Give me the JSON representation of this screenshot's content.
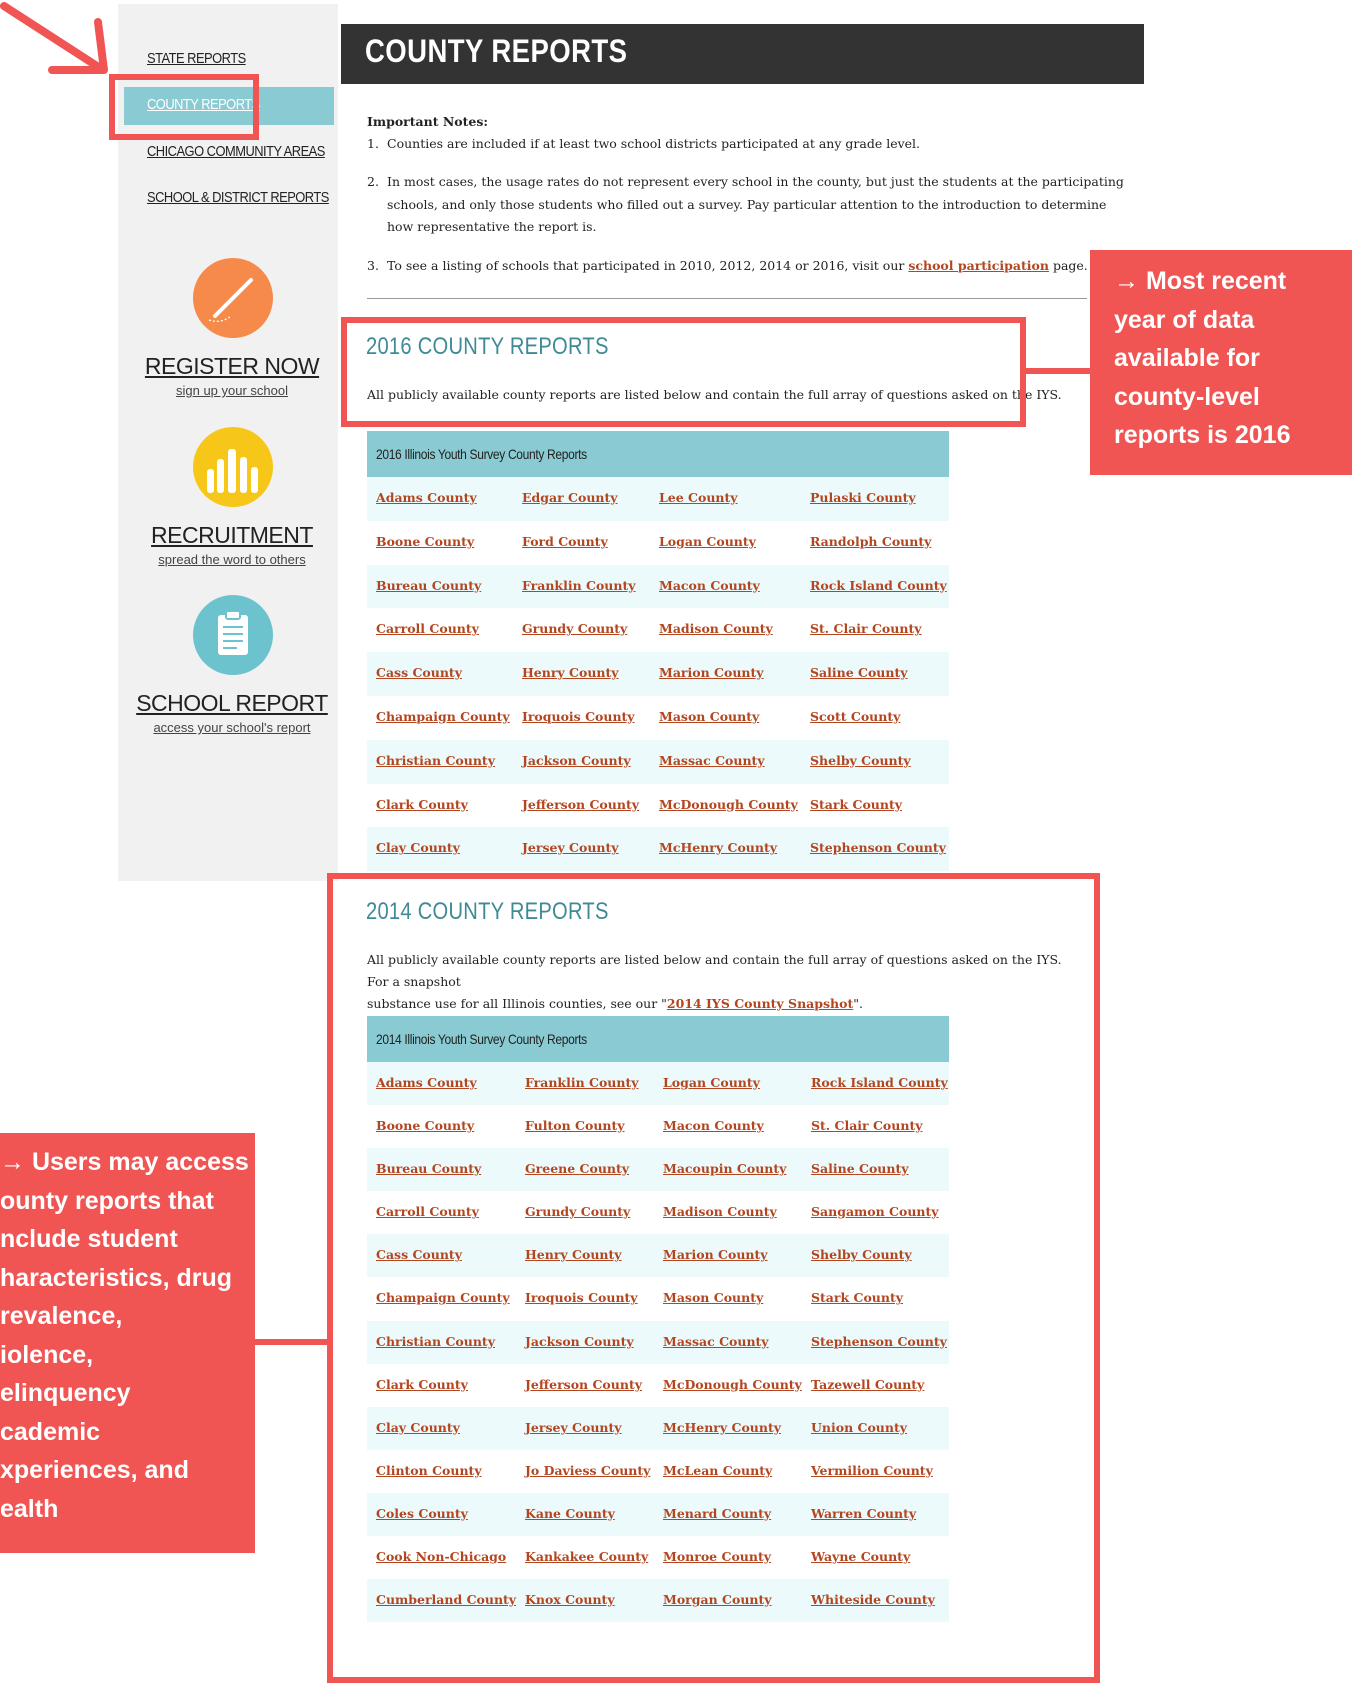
{
  "sidebar": {
    "nav": [
      {
        "label": "STATE REPORTS"
      },
      {
        "label": "COUNTY REPORTS"
      },
      {
        "label": "CHICAGO COMMUNITY AREAS"
      },
      {
        "label": "SCHOOL & DISTRICT REPORTS"
      }
    ],
    "promos": [
      {
        "title": "REGISTER NOW",
        "subtitle": "sign up your school",
        "icon": "pencil-icon",
        "color": "#f58a4b"
      },
      {
        "title": "RECRUITMENT",
        "subtitle": "spread the word to others",
        "icon": "raised-hands-icon",
        "color": "#f6c619"
      },
      {
        "title": "SCHOOL REPORT",
        "subtitle": "access your school's report",
        "icon": "clipboard-icon",
        "color": "#6cc3cd"
      }
    ]
  },
  "header": {
    "title": "COUNTY REPORTS"
  },
  "notes": {
    "heading": "Important Notes:",
    "items": [
      "Counties are included if at least two school districts participated at any grade level.",
      "In most cases, the usage rates do not represent every school in the county, but just the students at the participating schools, and only those students who filled out a survey.  Pay particular attention to the introduction to determine how representative the report is."
    ],
    "item3_prefix": "To see a listing of schools that participated in 2010, 2012, 2014 or 2016, visit our",
    "item3_link": "school participation",
    "item3_suffix": "page."
  },
  "section2016": {
    "title": "2016 COUNTY REPORTS",
    "description": "All publicly available county reports are listed below and contain the full array of questions asked on the IYS.",
    "table_title": "2016 Illinois Youth Survey County Reports",
    "rows": [
      [
        "Adams County",
        "Edgar County",
        "Lee County",
        "Pulaski County"
      ],
      [
        "Boone County",
        "Ford County",
        "Logan County",
        "Randolph County"
      ],
      [
        "Bureau County",
        "Franklin County",
        "Macon County",
        "Rock Island County"
      ],
      [
        "Carroll County",
        "Grundy County",
        "Madison County",
        "St. Clair County"
      ],
      [
        "Cass County",
        "Henry County",
        "Marion County",
        "Saline County"
      ],
      [
        "Champaign County",
        "Iroquois County",
        "Mason County",
        "Scott County"
      ],
      [
        "Christian County",
        "Jackson County",
        "Massac County",
        "Shelby County"
      ],
      [
        "Clark County",
        "Jefferson County",
        "McDonough County",
        "Stark County"
      ],
      [
        "Clay County",
        "Jersey County",
        "McHenry County",
        "Stephenson County"
      ]
    ]
  },
  "section2014": {
    "title": "2014 COUNTY REPORTS",
    "description_line1": "All publicly available county reports are listed below and contain the full array of questions asked on the IYS. For a snapshot",
    "description_line2_prefix": "substance use for all Illinois counties, see our \"",
    "description_link": "2014 IYS County Snapshot",
    "description_line2_suffix": "\".",
    "table_title": "2014 Illinois Youth Survey County Reports",
    "rows": [
      [
        "Adams County",
        "Franklin County",
        "Logan County",
        "Rock Island County"
      ],
      [
        "Boone County",
        "Fulton County",
        "Macon County",
        "St. Clair County"
      ],
      [
        "Bureau County",
        "Greene County",
        "Macoupin County",
        "Saline County"
      ],
      [
        "Carroll County",
        "Grundy County",
        "Madison County",
        "Sangamon County"
      ],
      [
        "Cass County",
        "Henry County",
        "Marion County",
        "Shelby County"
      ],
      [
        "Champaign County",
        "Iroquois County",
        "Mason County",
        "Stark County"
      ],
      [
        "Christian County",
        "Jackson County",
        "Massac County",
        "Stephenson County"
      ],
      [
        "Clark County",
        "Jefferson County",
        "McDonough County",
        "Tazewell County"
      ],
      [
        "Clay County",
        "Jersey County",
        "McHenry County",
        "Union County"
      ],
      [
        "Clinton County",
        "Jo Daviess County",
        "McLean County",
        "Vermilion County"
      ],
      [
        "Coles County",
        "Kane County",
        "Menard County",
        "Warren County"
      ],
      [
        "Cook Non-Chicago",
        "Kankakee County",
        "Monroe County",
        "Wayne County"
      ],
      [
        "Cumberland County",
        "Knox County",
        "Morgan County",
        "Whiteside County"
      ]
    ]
  },
  "annotations": {
    "right_callout": [
      "→ Most recent",
      "year of data",
      "available for",
      "county-level",
      "reports is 2016"
    ],
    "left_callout": [
      "→ Users may access",
      "ounty reports that",
      "nclude student",
      "haracteristics, drug",
      "revalence,",
      "iolence,",
      "elinquency",
      "cademic",
      "xperiences, and",
      "ealth"
    ],
    "accent_color": "#f05453"
  }
}
